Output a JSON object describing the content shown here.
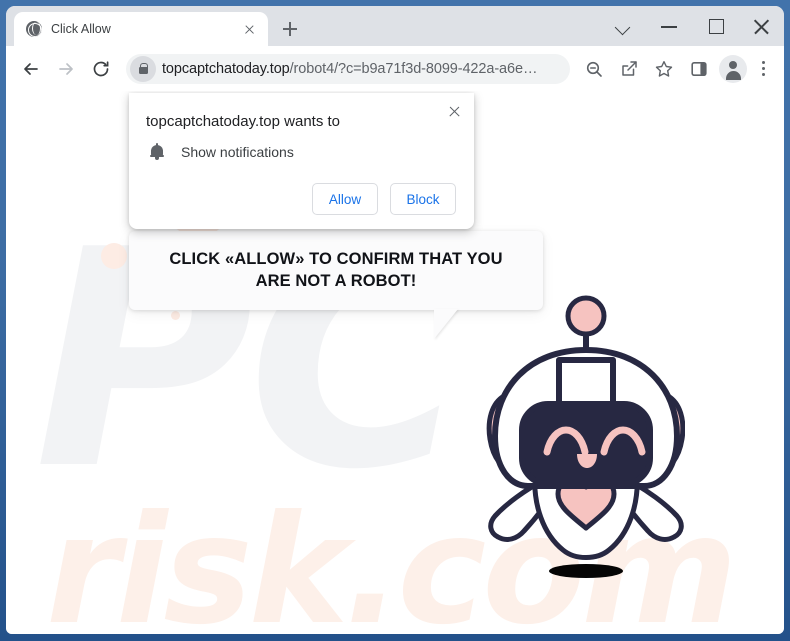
{
  "window": {
    "controls": [
      {
        "name": "tab-search",
        "icon": "chevron-down-icon"
      },
      {
        "name": "minimize",
        "icon": "minimize-icon"
      },
      {
        "name": "maximize",
        "icon": "maximize-icon"
      },
      {
        "name": "close",
        "icon": "close-icon"
      }
    ]
  },
  "tabstrip": {
    "tab": {
      "title": "Click Allow",
      "favicon": "globe-icon",
      "close_icon": "close-icon"
    },
    "new_tab_icon": "plus-icon"
  },
  "toolbar": {
    "back_icon": "arrow-left-icon",
    "forward_icon": "arrow-right-icon",
    "reload_icon": "reload-icon",
    "lock_icon": "lock-icon",
    "url_host": "topcaptchatoday.top",
    "url_path": "/robot4/?c=b9a71f3d-8099-422a-a6e…",
    "url_full": "topcaptchatoday.top/robot4/?c=b9a71f3d-8099-422a-a6e…",
    "zoom_out_icon": "zoom-out-icon",
    "share_icon": "share-icon",
    "bookmark_icon": "star-icon",
    "side_panel_icon": "side-panel-icon",
    "profile_icon": "avatar-icon",
    "menu_icon": "three-dot-menu-icon"
  },
  "notification_dialog": {
    "title": "topcaptchatoday.top wants to",
    "permission_icon": "bell-icon",
    "permission_label": "Show notifications",
    "allow_label": "Allow",
    "block_label": "Block",
    "close_icon": "close-icon"
  },
  "page": {
    "bubble_line1": "CLICK «ALLOW» TO CONFIRM THAT YOU",
    "bubble_line2": "ARE NOT A ROBOT!",
    "watermark_pc": "PC",
    "watermark_risk": "risk.com",
    "mascot": "robot-mascot"
  },
  "colors": {
    "frame_blue": "#3d6da4",
    "accent_blue": "#1a73e8",
    "robot_outline": "#272842",
    "robot_pink": "#f6c3c0",
    "bubble_bg": "#fbfbfc",
    "watermark_gray": "#f2f3f5",
    "watermark_peach": "#fdf0e9"
  }
}
